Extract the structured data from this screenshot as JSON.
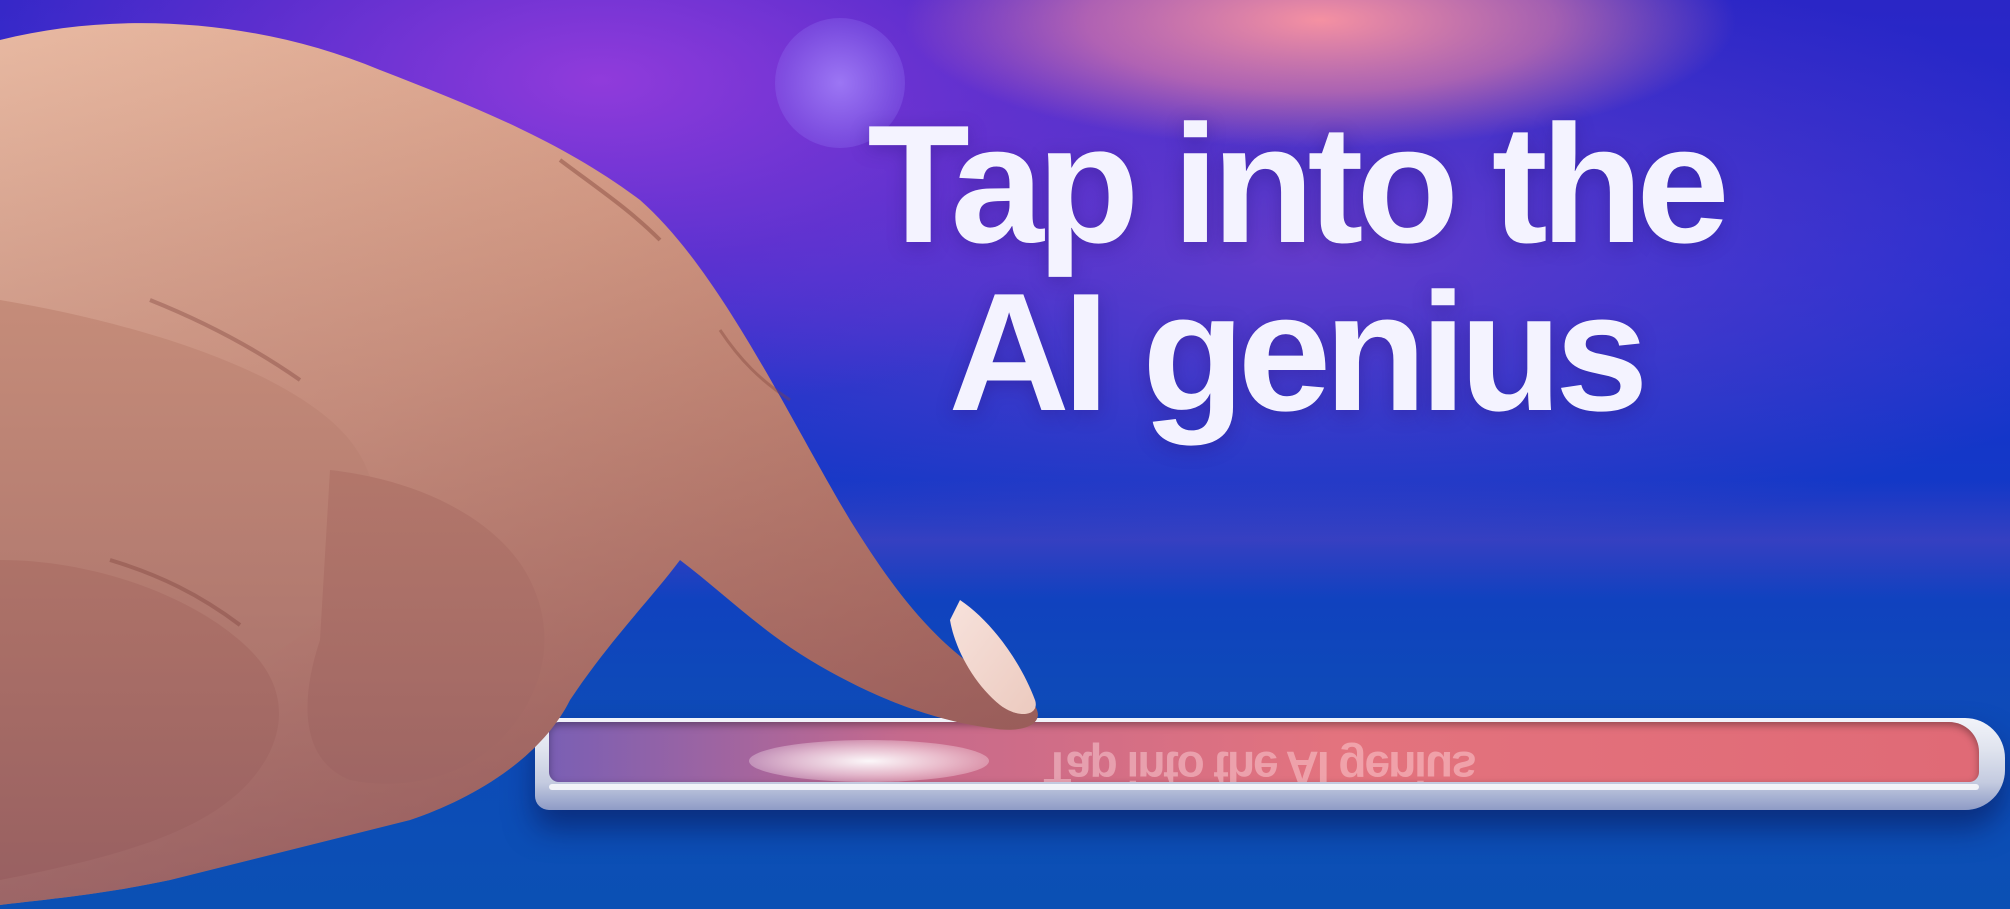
{
  "headline": {
    "line1": "Tap into the",
    "line2": "AI genius"
  },
  "scene": {
    "description_icons": [
      "hand-icon",
      "smartphone-icon"
    ],
    "colors": {
      "background_blue": "#1b2fd0",
      "glow_purple": "#963cdc",
      "glow_pink": "#ff96a0",
      "screen_pink": "#e3737e",
      "text_white": "#f4f3ff"
    }
  },
  "phone": {
    "screen_reflection": "Tap into the AI genius"
  }
}
